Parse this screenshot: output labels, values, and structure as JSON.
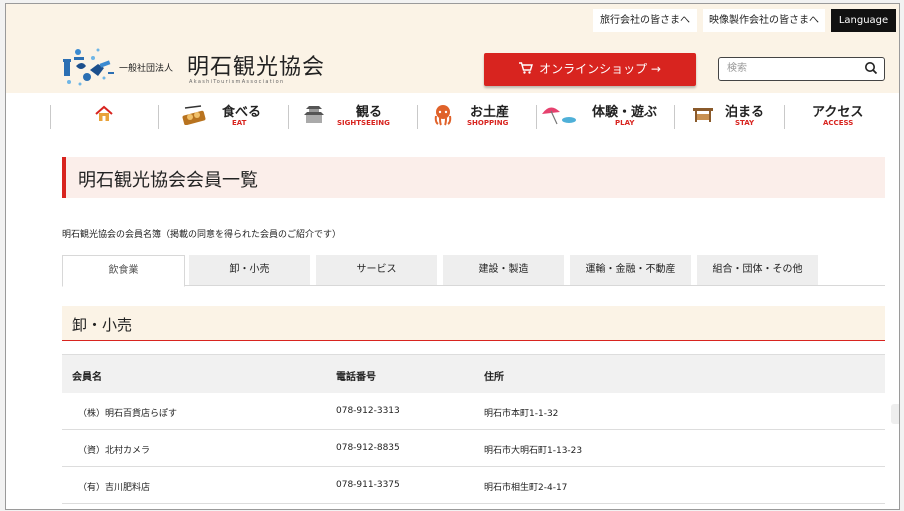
{
  "topbar": {
    "links": [
      "旅行会社の皆さまへ",
      "映像製作会社の皆さまへ"
    ],
    "language": "Language"
  },
  "header": {
    "logo_small": "一般社団法人",
    "logo_name": "明石観光協会",
    "logo_sub": "AkashiTourismAssociation",
    "shop_label": "オンラインショップ →",
    "search_placeholder": "検索"
  },
  "nav": {
    "items": [
      {
        "jp": "食べる",
        "en": "EAT"
      },
      {
        "jp": "観る",
        "en": "SIGHTSEEING"
      },
      {
        "jp": "お土産",
        "en": "SHOPPING"
      },
      {
        "jp": "体験・遊ぶ",
        "en": "PLAY"
      },
      {
        "jp": "泊まる",
        "en": "STAY"
      },
      {
        "jp": "アクセス",
        "en": "ACCESS"
      }
    ]
  },
  "page": {
    "title": "明石観光協会会員一覧",
    "description": "明石観光協会の会員名簿（掲載の同意を得られた会員のご紹介です）"
  },
  "tabs": [
    "飲食業",
    "卸・小売",
    "サービス",
    "建設・製造",
    "運輸・金融・不動産",
    "組合・団体・その他"
  ],
  "section": {
    "title": "卸・小売"
  },
  "table": {
    "headers": [
      "会員名",
      "電話番号",
      "住所"
    ],
    "rows": [
      [
        "（株）明石百貨店らぽす",
        "078-912-3313",
        "明石市本町1-1-32"
      ],
      [
        "（資）北村カメラ",
        "078-912-8835",
        "明石市大明石町1-13-23"
      ],
      [
        "（有）吉川肥料店",
        "078-911-3375",
        "明石市相生町2-4-17"
      ]
    ]
  },
  "colors": {
    "accent": "#d8241f",
    "cream": "#fbf3e6",
    "pink": "#fbeeea"
  }
}
